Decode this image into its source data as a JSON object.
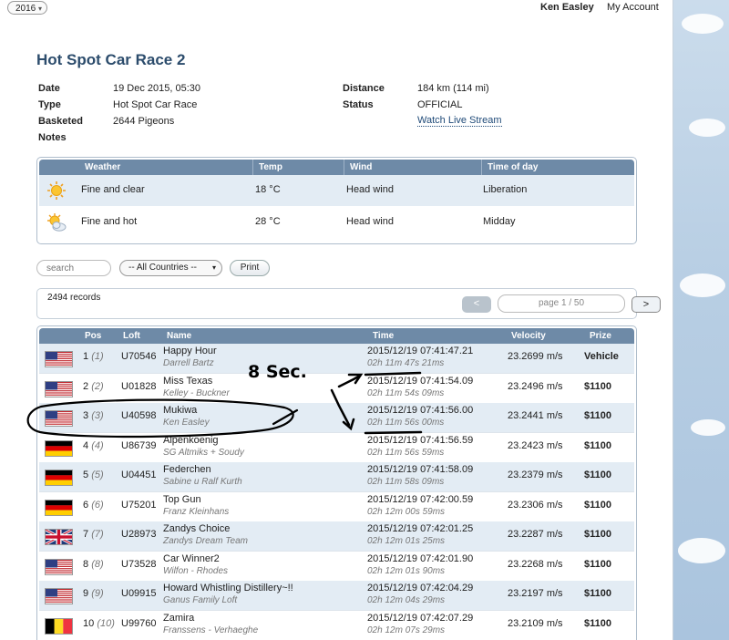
{
  "topbar": {
    "year": "2016",
    "user_name": "Ken Easley",
    "my_account": "My Account"
  },
  "race": {
    "title": "Hot Spot Car Race 2",
    "date_label": "Date",
    "date": "19 Dec 2015, 05:30",
    "type_label": "Type",
    "type": "Hot Spot Car Race",
    "basketed_label": "Basketed",
    "basketed": "2644 Pigeons",
    "notes_label": "Notes",
    "distance_label": "Distance",
    "distance": "184 km (114 mi)",
    "status_label": "Status",
    "status": "OFFICIAL",
    "watch_link": "Watch Live Stream"
  },
  "weather": {
    "headers": {
      "weather": "Weather",
      "temp": "Temp",
      "wind": "Wind",
      "time_of_day": "Time of day"
    },
    "rows": [
      {
        "icon": "sun-icon",
        "weather": "Fine and clear",
        "temp": "18 °C",
        "wind": "Head wind",
        "time_of_day": "Liberation"
      },
      {
        "icon": "sun-cloud-icon",
        "weather": "Fine and hot",
        "temp": "28 °C",
        "wind": "Head wind",
        "time_of_day": "Midday"
      }
    ]
  },
  "filters": {
    "search_placeholder": "search",
    "country": "-- All Countries --",
    "print": "Print"
  },
  "records": {
    "count": "2494 records",
    "prev": "<",
    "page": "page 1 / 50",
    "next": ">"
  },
  "results": {
    "headers": {
      "pos": "Pos",
      "loft": "Loft",
      "name": "Name",
      "time": "Time",
      "velocity": "Velocity",
      "prize": "Prize"
    },
    "rows": [
      {
        "flag": "us",
        "pos": "1",
        "pos_paren": "(1)",
        "loft": "U70546",
        "name": "Happy Hour",
        "owner": "Darrell Bartz",
        "time": "2015/12/19 07:41:47.21",
        "duration": "02h 11m 47s 21ms",
        "velocity": "23.2699 m/s",
        "prize": "Vehicle"
      },
      {
        "flag": "us",
        "pos": "2",
        "pos_paren": "(2)",
        "loft": "U01828",
        "name": "Miss Texas",
        "owner": "Kelley - Buckner",
        "time": "2015/12/19 07:41:54.09",
        "duration": "02h 11m 54s 09ms",
        "velocity": "23.2496 m/s",
        "prize": "$1100"
      },
      {
        "flag": "us",
        "pos": "3",
        "pos_paren": "(3)",
        "loft": "U40598",
        "name": "Mukiwa",
        "owner": "Ken Easley",
        "time": "2015/12/19 07:41:56.00",
        "duration": "02h 11m 56s 00ms",
        "velocity": "23.2441 m/s",
        "prize": "$1100"
      },
      {
        "flag": "de",
        "pos": "4",
        "pos_paren": "(4)",
        "loft": "U86739",
        "name": "Alpenkoenig",
        "owner": "SG Altmiks + Soudy",
        "time": "2015/12/19 07:41:56.59",
        "duration": "02h 11m 56s 59ms",
        "velocity": "23.2423 m/s",
        "prize": "$1100"
      },
      {
        "flag": "de",
        "pos": "5",
        "pos_paren": "(5)",
        "loft": "U04451",
        "name": "Federchen",
        "owner": "Sabine u Ralf Kurth",
        "time": "2015/12/19 07:41:58.09",
        "duration": "02h 11m 58s 09ms",
        "velocity": "23.2379 m/s",
        "prize": "$1100"
      },
      {
        "flag": "de",
        "pos": "6",
        "pos_paren": "(6)",
        "loft": "U75201",
        "name": "Top Gun",
        "owner": "Franz Kleinhans",
        "time": "2015/12/19 07:42:00.59",
        "duration": "02h 12m 00s 59ms",
        "velocity": "23.2306 m/s",
        "prize": "$1100"
      },
      {
        "flag": "uk",
        "pos": "7",
        "pos_paren": "(7)",
        "loft": "U28973",
        "name": "Zandys Choice",
        "owner": "Zandys Dream Team",
        "time": "2015/12/19 07:42:01.25",
        "duration": "02h 12m 01s 25ms",
        "velocity": "23.2287 m/s",
        "prize": "$1100"
      },
      {
        "flag": "us",
        "pos": "8",
        "pos_paren": "(8)",
        "loft": "U73528",
        "name": "Car Winner2",
        "owner": "Wilfon - Rhodes",
        "time": "2015/12/19 07:42:01.90",
        "duration": "02h 12m 01s 90ms",
        "velocity": "23.2268 m/s",
        "prize": "$1100"
      },
      {
        "flag": "us",
        "pos": "9",
        "pos_paren": "(9)",
        "loft": "U09915",
        "name": "Howard Whistling Distillery~!!",
        "owner": "Ganus Family Loft",
        "time": "2015/12/19 07:42:04.29",
        "duration": "02h 12m 04s 29ms",
        "velocity": "23.2197 m/s",
        "prize": "$1100"
      },
      {
        "flag": "be",
        "pos": "10",
        "pos_paren": "(10)",
        "loft": "U99760",
        "name": "Zamira",
        "owner": "Franssens - Verhaeghe",
        "time": "2015/12/19 07:42:07.29",
        "duration": "02h 12m 07s 29ms",
        "velocity": "23.2109 m/s",
        "prize": "$1100"
      }
    ]
  },
  "annotation": {
    "text": "8 Sec."
  }
}
